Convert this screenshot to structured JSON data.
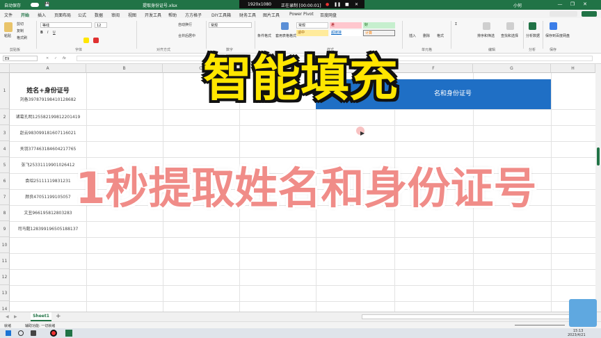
{
  "titlebar": {
    "autosave": "自动保存",
    "filename": "提取身份证号.xlsx",
    "rec_size": "1920x1080",
    "rec_status": "正在录制 [00:00:01]",
    "user": "小何",
    "bg": "#217346"
  },
  "menu": {
    "tabs": [
      "文件",
      "开始",
      "插入",
      "页面布局",
      "公式",
      "数据",
      "审阅",
      "视图",
      "开发工具",
      "帮助",
      "方方格子",
      "DIY工具箱",
      "财务工具",
      "图片工具",
      "Power Pivot",
      "百度网盘"
    ],
    "active_index": 1
  },
  "ribbon": {
    "clipboard": {
      "paste": "粘贴",
      "cut": "剪切",
      "copy": "复制",
      "format_painter": "格式刷",
      "group": "剪贴板"
    },
    "font": {
      "name": "等线",
      "size": "12",
      "group": "字体"
    },
    "align": {
      "wrap": "自动换行",
      "merge": "合并后居中",
      "group": "对齐方式"
    },
    "number": {
      "format": "常规",
      "group": "数字"
    },
    "styles": {
      "conditional": "条件格式",
      "table": "套用表格格式",
      "normal": "常规",
      "bad": "差",
      "good": "好",
      "neutral": "适中",
      "hyperlink": "超链接",
      "calc": "计算",
      "group": "样式"
    },
    "cells": {
      "insert": "插入",
      "delete": "删除",
      "format": "格式",
      "group": "单元格"
    },
    "editing": {
      "sort": "排序和筛选",
      "find": "查找和选择",
      "group": "编辑"
    },
    "analysis": {
      "analyze": "分析数据",
      "group": "分析"
    },
    "baidu": {
      "save": "保存到百度网盘",
      "group": "保存"
    }
  },
  "formula_bar": {
    "namebox": "E9",
    "fx": "fx",
    "value": ""
  },
  "sheet": {
    "columns": [
      "A",
      "B",
      "C",
      "D",
      "E",
      "F",
      "G",
      "H"
    ],
    "rows": [
      "1",
      "2",
      "3",
      "4",
      "5",
      "6",
      "7",
      "8",
      "9",
      "10",
      "11",
      "12",
      "13",
      "14"
    ],
    "header_cell": "姓名+身份证号",
    "data": [
      "刘备397879198410128682",
      "诸葛孔明125582199812201419",
      "赵云983099181607116021",
      "关羽377463184604217765",
      "张飞25331119901026412",
      "袁绍25111119831231",
      "颜良47051199105057",
      "文丑966195812803283",
      "司马懿128399196505188137"
    ],
    "header_fill": "#1f6fc5",
    "header_text": "名和身份证号"
  },
  "overlay": {
    "title": "智能填充",
    "subtitle": "1秒提取姓名和身份证号"
  },
  "sheettabs": {
    "active": "Sheet1",
    "add": "+"
  },
  "statusbar": {
    "ready": "就绪",
    "accessibility": "辅助功能: 一切就绪",
    "zoom": "100%"
  },
  "taskbar": {
    "time": "15:13",
    "date": "2023/4/21"
  }
}
